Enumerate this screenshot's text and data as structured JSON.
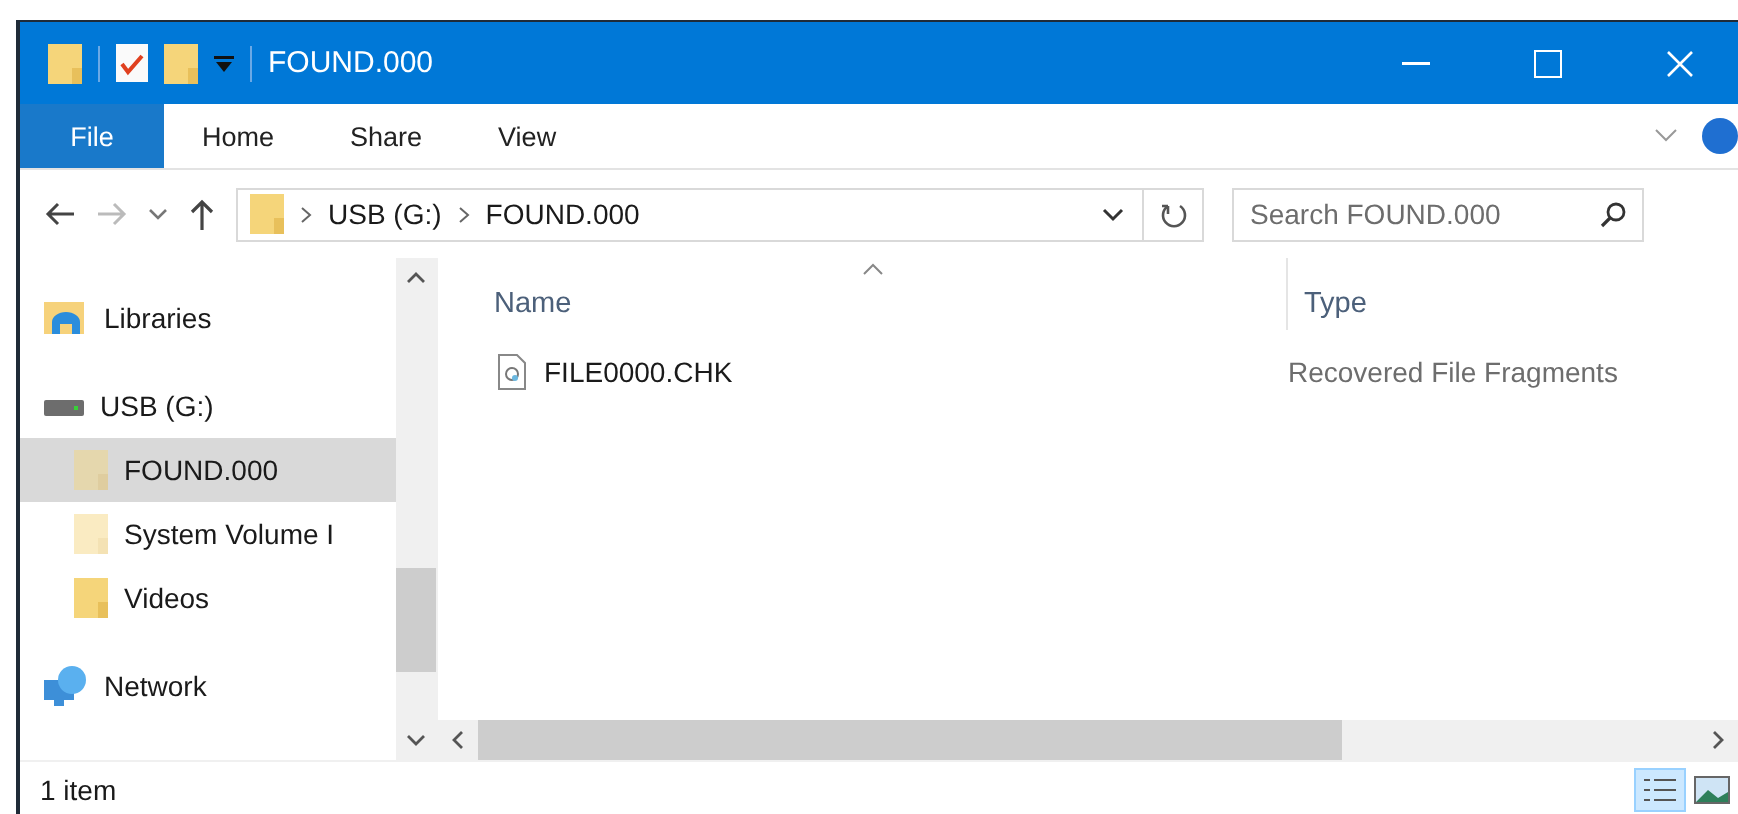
{
  "window": {
    "title": "FOUND.000"
  },
  "ribbon": {
    "tabs": [
      {
        "label": "File",
        "kind": "file"
      },
      {
        "label": "Home",
        "kind": "tab"
      },
      {
        "label": "Share",
        "kind": "tab"
      },
      {
        "label": "View",
        "kind": "tab"
      }
    ]
  },
  "address": {
    "path": [
      "USB (G:)",
      "FOUND.000"
    ]
  },
  "search": {
    "placeholder": "Search FOUND.000"
  },
  "navigation": {
    "items": [
      {
        "label": "Libraries",
        "kind": "libraries",
        "selected": false
      },
      {
        "label": "USB (G:)",
        "kind": "drive",
        "selected": false,
        "children": [
          {
            "label": "FOUND.000",
            "kind": "folder",
            "selected": true,
            "hidden": true
          },
          {
            "label": "System Volume I",
            "kind": "folder",
            "selected": false,
            "hidden": true
          },
          {
            "label": "Videos",
            "kind": "folder",
            "selected": false,
            "hidden": false
          }
        ]
      },
      {
        "label": "Network",
        "kind": "network",
        "selected": false
      }
    ]
  },
  "columns": [
    {
      "label": "Name",
      "sorted": true
    },
    {
      "label": "Type",
      "sorted": false
    }
  ],
  "rows": [
    {
      "name": "FILE0000.CHK",
      "type": "Recovered File Fragments",
      "selected": false
    }
  ],
  "status_bar": {
    "text": "1 item",
    "views": [
      {
        "kind": "details",
        "selected": true
      },
      {
        "kind": "large",
        "selected": false
      }
    ]
  }
}
